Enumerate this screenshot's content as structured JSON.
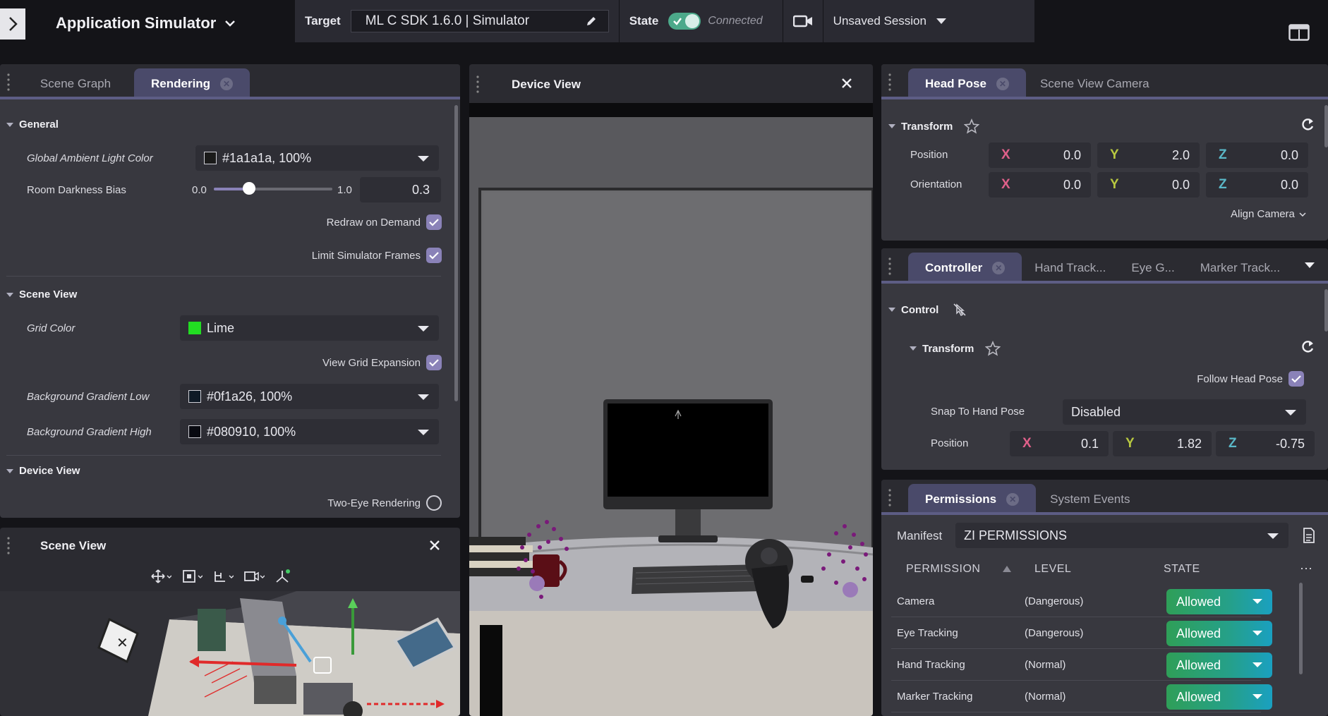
{
  "app": {
    "title": "Application Simulator"
  },
  "toolbar": {
    "target_label": "Target",
    "target_value": "ML C SDK 1.6.0 | Simulator",
    "state_label": "State",
    "state_value": "Connected",
    "session": "Unsaved Session"
  },
  "left_panel": {
    "tabs": [
      {
        "label": "Scene Graph"
      },
      {
        "label": "Rendering"
      }
    ],
    "general": {
      "title": "General",
      "ambient_label": "Global Ambient Light Color",
      "ambient_value": "#1a1a1a, 100%",
      "darkness_label": "Room Darkness Bias",
      "darkness_min": "0.0",
      "darkness_max": "1.0",
      "darkness_value": "0.3",
      "darkness_fraction": 0.3,
      "redraw_label": "Redraw on Demand",
      "limit_label": "Limit Simulator Frames"
    },
    "scene_view": {
      "title": "Scene View",
      "grid_color_label": "Grid Color",
      "grid_color_value": "Lime",
      "grid_color_hex": "#22dd22",
      "grid_expansion_label": "View Grid Expansion",
      "bg_low_label": "Background Gradient Low",
      "bg_low_value": "#0f1a26, 100%",
      "bg_high_label": "Background Gradient High",
      "bg_high_value": "#080910, 100%"
    },
    "device_view": {
      "title": "Device View",
      "two_eye_label": "Two-Eye Rendering"
    }
  },
  "scene_view_panel": {
    "title": "Scene View"
  },
  "device_view_panel": {
    "title": "Device View"
  },
  "head_pose": {
    "tabs": [
      {
        "label": "Head Pose"
      },
      {
        "label": "Scene View Camera"
      }
    ],
    "transform_label": "Transform",
    "position_label": "Position",
    "orientation_label": "Orientation",
    "axis": {
      "x": "X",
      "y": "Y",
      "z": "Z"
    },
    "position": {
      "x": "0.0",
      "y": "2.0",
      "z": "0.0"
    },
    "orientation": {
      "x": "0.0",
      "y": "0.0",
      "z": "0.0"
    },
    "align_camera": "Align Camera"
  },
  "controller": {
    "tabs": [
      {
        "label": "Controller"
      },
      {
        "label": "Hand Track..."
      },
      {
        "label": "Eye G..."
      },
      {
        "label": "Marker Track..."
      }
    ],
    "control_label": "Control",
    "transform_label": "Transform",
    "follow_head_pose": "Follow Head Pose",
    "snap_label": "Snap To Hand Pose",
    "snap_value": "Disabled",
    "position_label": "Position",
    "position": {
      "x": "0.1",
      "y": "1.82",
      "z": "-0.75"
    }
  },
  "permissions": {
    "tabs": [
      {
        "label": "Permissions"
      },
      {
        "label": "System Events"
      }
    ],
    "manifest_label": "Manifest",
    "manifest_value": "ZI PERMISSIONS",
    "columns": {
      "permission": "PERMISSION",
      "level": "LEVEL",
      "state": "STATE"
    },
    "rows": [
      {
        "name": "Camera",
        "level": "(Dangerous)",
        "state": "Allowed"
      },
      {
        "name": "Eye Tracking",
        "level": "(Dangerous)",
        "state": "Allowed"
      },
      {
        "name": "Hand Tracking",
        "level": "(Normal)",
        "state": "Allowed"
      },
      {
        "name": "Marker Tracking",
        "level": "(Normal)",
        "state": "Allowed"
      }
    ]
  },
  "colors": {
    "accent": "#5d5d85",
    "checkbox": "#8a82b8",
    "connected_toggle": "#4ca98a",
    "allowed_start": "#2f9f58",
    "allowed_end": "#1aa0c0"
  }
}
